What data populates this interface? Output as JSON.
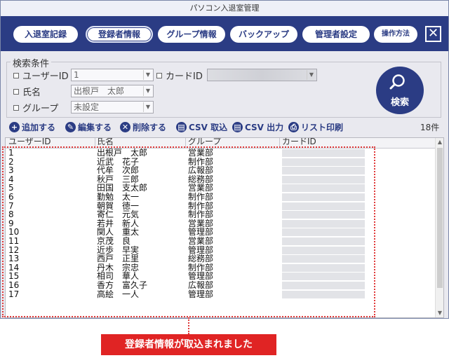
{
  "window": {
    "title": "パソコン入退室管理"
  },
  "nav": {
    "items": [
      {
        "label": "入退室記録"
      },
      {
        "label": "登録者情報"
      },
      {
        "label": "グループ情報"
      },
      {
        "label": "バックアップ"
      },
      {
        "label": "管理者設定"
      },
      {
        "label": "操作方法"
      }
    ],
    "close_glyph": "✕"
  },
  "search": {
    "legend": "検索条件",
    "user_id_label": "ユーザーID",
    "user_id_value": "1",
    "card_id_label": "カードID",
    "name_label": "氏名",
    "name_value": "出根戸　太郎",
    "group_label": "グループ",
    "group_value": "未設定",
    "button_label": "検索"
  },
  "toolbar": {
    "add": "追加する",
    "edit": "編集する",
    "delete": "削除する",
    "csv_import": "CSV 取込",
    "csv_export": "CSV 出力",
    "print": "リスト印刷",
    "count": "18件"
  },
  "table": {
    "columns": [
      "ユーザーID",
      "氏名",
      "グループ",
      "カードID"
    ],
    "rows": [
      [
        "1",
        "出根戸　太郎",
        "営業部"
      ],
      [
        "2",
        "近武　花子",
        "制作部"
      ],
      [
        "3",
        "代牟　次郎",
        "広報部"
      ],
      [
        "4",
        "秋戸　三郎",
        "総務部"
      ],
      [
        "5",
        "田国　支太郎",
        "営業部"
      ],
      [
        "6",
        "勤勉　太一",
        "制作部"
      ],
      [
        "7",
        "朝賀　徳一",
        "制作部"
      ],
      [
        "8",
        "寄仁　元気",
        "制作部"
      ],
      [
        "9",
        "若井　新人",
        "営業部"
      ],
      [
        "10",
        "関人　重太",
        "管理部"
      ],
      [
        "11",
        "京茂　良",
        "営業部"
      ],
      [
        "12",
        "近歩　早実",
        "管理部"
      ],
      [
        "13",
        "西戸　正里",
        "総務部"
      ],
      [
        "14",
        "丹木　宗忠",
        "制作部"
      ],
      [
        "15",
        "相司　華人",
        "管理部"
      ],
      [
        "16",
        "香方　富久子",
        "広報部"
      ],
      [
        "17",
        "高絵　一人",
        "管理部"
      ]
    ]
  },
  "notice": "登録者情報が取込まれました",
  "colors": {
    "brand": "#2b3c84",
    "alert": "#e02424"
  }
}
